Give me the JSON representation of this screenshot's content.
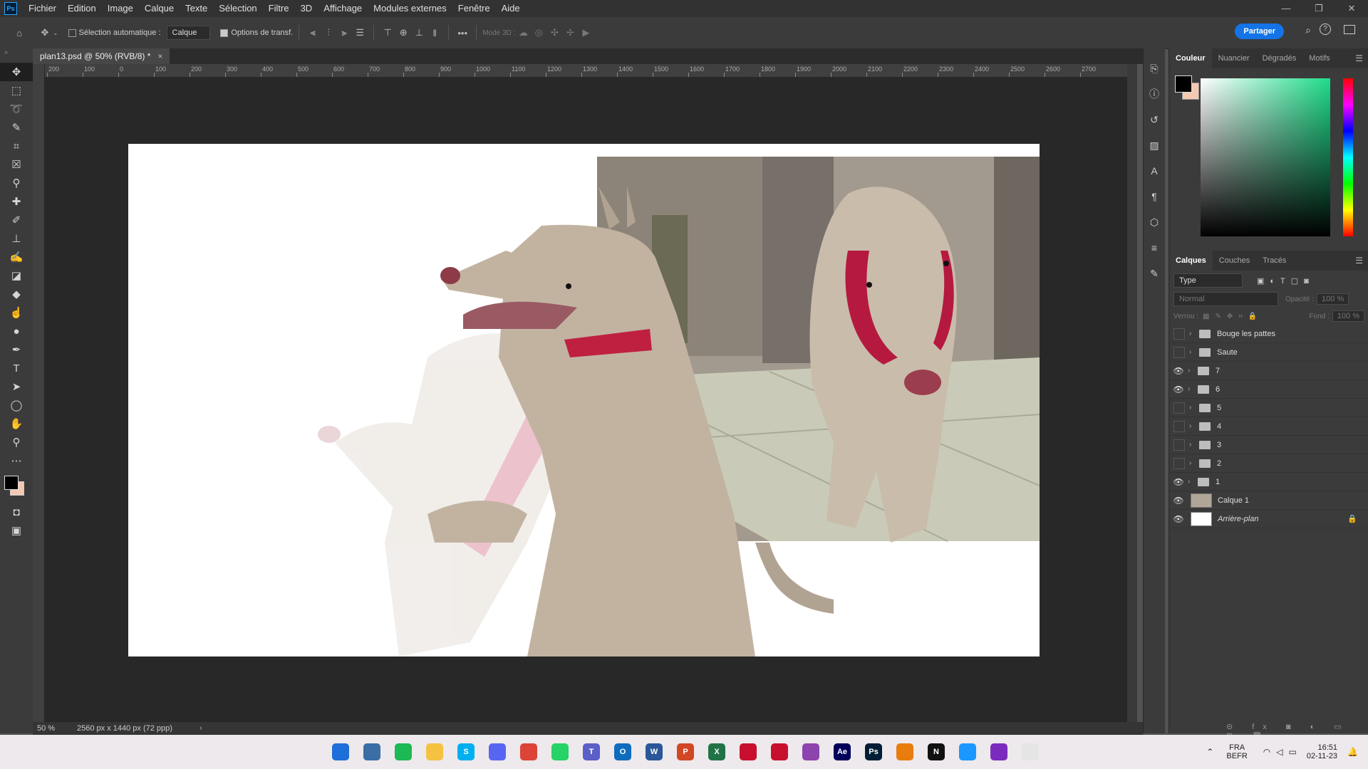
{
  "app": {
    "logo": "Ps"
  },
  "menu": [
    "Fichier",
    "Edition",
    "Image",
    "Calque",
    "Texte",
    "Sélection",
    "Filtre",
    "3D",
    "Affichage",
    "Modules externes",
    "Fenêtre",
    "Aide"
  ],
  "window_controls": [
    "—",
    "❐",
    "✕"
  ],
  "options": {
    "auto_select_label": "Sélection automatique :",
    "auto_select_value": "Calque",
    "transform_label": "Options de transf.",
    "mode3d_label": "Mode 3D :",
    "share_label": "Partager"
  },
  "document": {
    "tab_title": "plan13.psd @ 50% (RVB/8) *",
    "zoom": "50 %",
    "dimensions": "2560 px x 1440 px (72 ppp)"
  },
  "ruler_labels": [
    "200",
    "100",
    "0",
    "100",
    "200",
    "300",
    "400",
    "500",
    "600",
    "700",
    "800",
    "900",
    "1000",
    "1100",
    "1200",
    "1300",
    "1400",
    "1500",
    "1600",
    "1700",
    "1800",
    "1900",
    "2000",
    "2100",
    "2200",
    "2300",
    "2400",
    "2500",
    "2600",
    "2700"
  ],
  "color_panel": {
    "tabs": [
      "Couleur",
      "Nuancier",
      "Dégradés",
      "Motifs"
    ],
    "active_tab": "Couleur",
    "foreground": "#000000",
    "background": "#f4c9b2",
    "picker_hue": "#1fdc8a"
  },
  "layers_panel": {
    "tabs": [
      "Calques",
      "Couches",
      "Tracés"
    ],
    "filter_label": "Type",
    "blend_mode": "Normal",
    "opacity_label": "Opacité :",
    "opacity_value": "100 %",
    "lock_label": "Verrou :",
    "fill_label": "Fond :",
    "fill_value": "100 %",
    "layers": [
      {
        "name": "Bouge les pattes",
        "type": "group",
        "visible": false
      },
      {
        "name": "Saute",
        "type": "group",
        "visible": false
      },
      {
        "name": "7",
        "type": "group",
        "visible": true
      },
      {
        "name": "6",
        "type": "group",
        "visible": true
      },
      {
        "name": "5",
        "type": "group",
        "visible": false
      },
      {
        "name": "4",
        "type": "group",
        "visible": false
      },
      {
        "name": "3",
        "type": "group",
        "visible": false
      },
      {
        "name": "2",
        "type": "group",
        "visible": false
      },
      {
        "name": "1",
        "type": "group",
        "visible": true
      },
      {
        "name": "Calque 1",
        "type": "pixel",
        "visible": true
      },
      {
        "name": "Arrière-plan",
        "type": "background",
        "visible": true,
        "locked": true
      }
    ]
  },
  "taskbar": {
    "lang_top": "FRA",
    "lang_bottom": "BEFR",
    "time": "16:51",
    "date": "02-11-23",
    "apps": [
      {
        "name": "start",
        "label": "",
        "color": "#1e6fd9"
      },
      {
        "name": "game",
        "label": "",
        "color": "#3a6ea5"
      },
      {
        "name": "spotify",
        "label": "",
        "color": "#1db954"
      },
      {
        "name": "explorer",
        "label": "",
        "color": "#f5c242"
      },
      {
        "name": "skype",
        "label": "S",
        "color": "#00aff0"
      },
      {
        "name": "discord",
        "label": "",
        "color": "#5865f2"
      },
      {
        "name": "chrome",
        "label": "",
        "color": "#db4437"
      },
      {
        "name": "whatsapp",
        "label": "",
        "color": "#25d366"
      },
      {
        "name": "teams",
        "label": "T",
        "color": "#5b5fc7"
      },
      {
        "name": "outlook",
        "label": "O",
        "color": "#0f6cbd"
      },
      {
        "name": "word",
        "label": "W",
        "color": "#2b579a"
      },
      {
        "name": "powerpoint",
        "label": "P",
        "color": "#d24726"
      },
      {
        "name": "excel",
        "label": "X",
        "color": "#217346"
      },
      {
        "name": "app-red-1",
        "label": "",
        "color": "#c8102e"
      },
      {
        "name": "app-red-2",
        "label": "",
        "color": "#c8102e"
      },
      {
        "name": "color-wheel",
        "label": "",
        "color": "#8e44ad"
      },
      {
        "name": "after-effects",
        "label": "Ae",
        "color": "#00005b"
      },
      {
        "name": "photoshop",
        "label": "Ps",
        "color": "#001e36"
      },
      {
        "name": "blender",
        "label": "",
        "color": "#e87d0d"
      },
      {
        "name": "netflix",
        "label": "N",
        "color": "#111111"
      },
      {
        "name": "prime-video",
        "label": "",
        "color": "#1a98ff"
      },
      {
        "name": "app-purple",
        "label": "",
        "color": "#7b2cbf"
      },
      {
        "name": "snipping",
        "label": "",
        "color": "#e5e5e5"
      }
    ]
  }
}
